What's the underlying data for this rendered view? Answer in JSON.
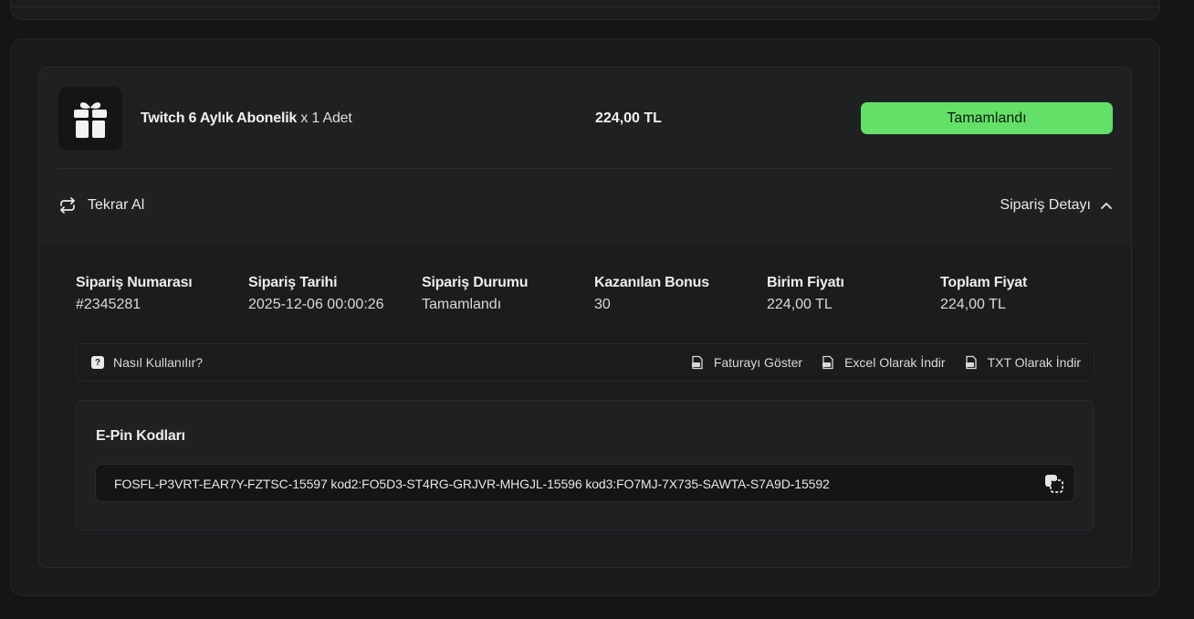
{
  "order": {
    "product_name": "Twitch 6 Aylık Abonelik",
    "quantity_text": "x 1 Adet",
    "price": "224,00 TL",
    "status_label": "Tamamlandı",
    "status_color": "#63e067",
    "reorder_label": "Tekrar Al",
    "detail_toggle_label": "Sipariş Detayı"
  },
  "details": [
    {
      "label": "Sipariş Numarası",
      "value": "#2345281"
    },
    {
      "label": "Sipariş Tarihi",
      "value": "2025-12-06 00:00:26"
    },
    {
      "label": "Sipariş Durumu",
      "value": "Tamamlandı"
    },
    {
      "label": "Kazanılan Bonus",
      "value": "30"
    },
    {
      "label": "Birim Fiyatı",
      "value": "224,00 TL"
    },
    {
      "label": "Toplam Fiyat",
      "value": "224,00 TL"
    }
  ],
  "action_bar": {
    "howto_label": "Nasıl Kullanılır?",
    "invoice_label": "Faturayı Göster",
    "excel_label": "Excel Olarak İndir",
    "txt_label": "TXT Olarak İndir"
  },
  "epin": {
    "title": "E-Pin Kodları",
    "codes": "FOSFL-P3VRT-EAR7Y-FZTSC-15597 kod2:FO5D3-ST4RG-GRJVR-MHGJL-15596 kod3:FO7MJ-7X735-SAWTA-S7A9D-15592"
  },
  "icons": {
    "product": "gift-icon",
    "reorder": "refresh-icon",
    "toggle": "chevron-up-icon",
    "howto": "question-icon",
    "file": "file-icon",
    "copy": "copy-icon"
  }
}
